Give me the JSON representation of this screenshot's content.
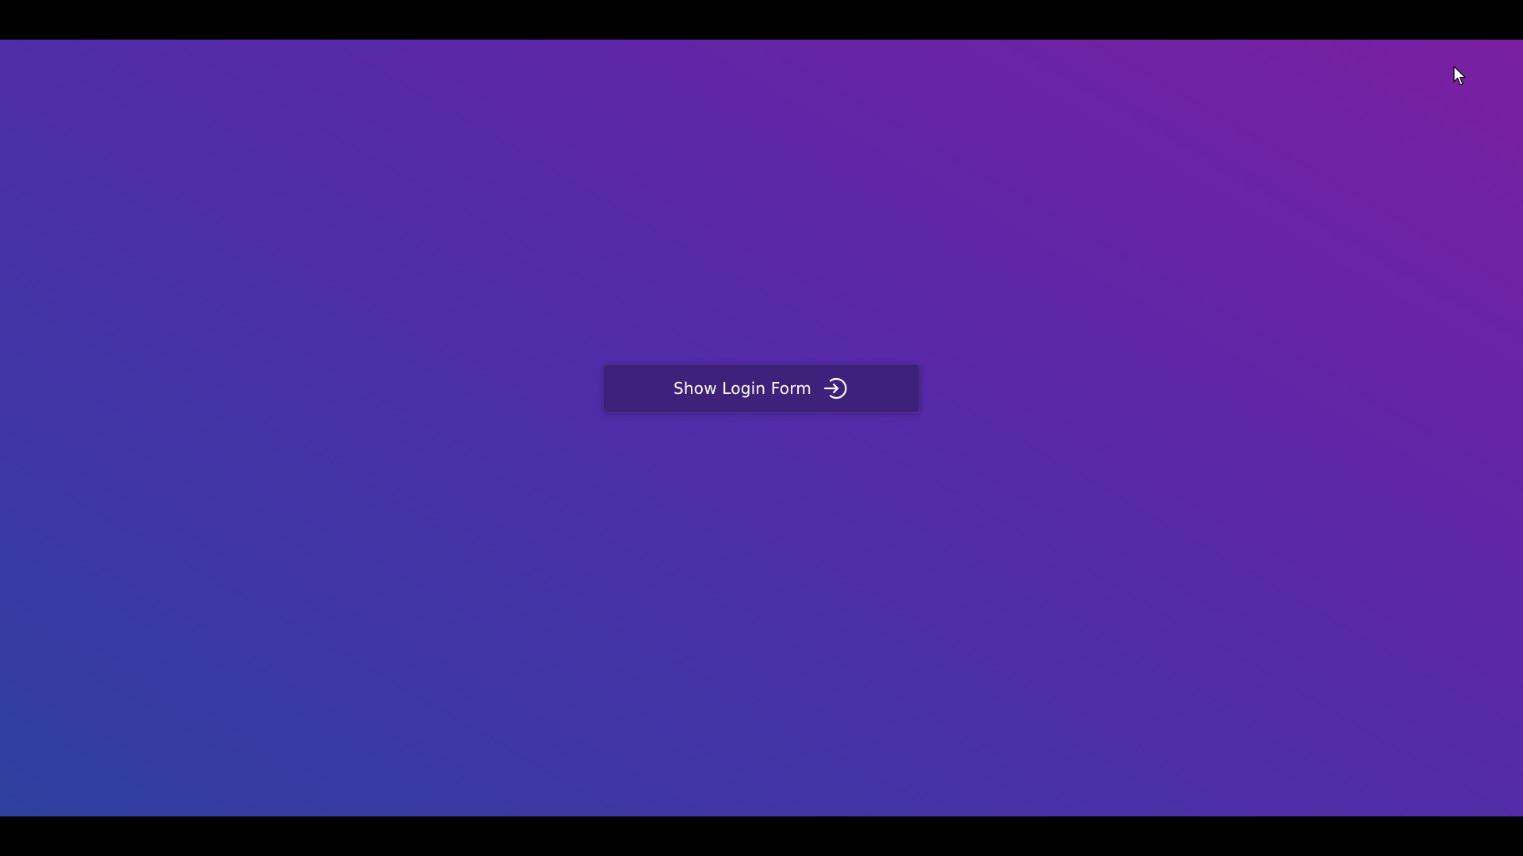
{
  "login_button": {
    "label": "Show Login Form",
    "icon": "login-arrow-icon"
  },
  "cursor": {
    "icon": "mouse-pointer-icon"
  },
  "colors": {
    "background_gradient": [
      "#2e40a0",
      "#4a30a8",
      "#5a28a8",
      "#7a1fa2"
    ],
    "button_background": "#3d217a",
    "button_text": "#ffffff",
    "letterbox": "#000000"
  }
}
